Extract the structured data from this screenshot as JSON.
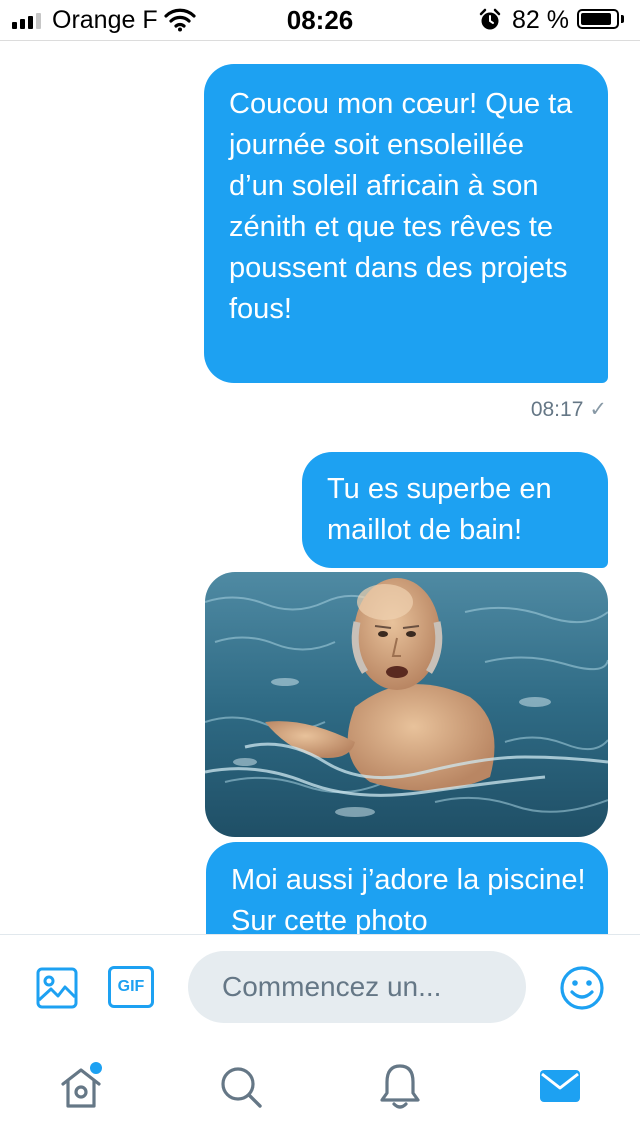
{
  "status_bar": {
    "carrier": "Orange F",
    "time": "08:26",
    "battery_percent": "82 %",
    "signal_bars_active": 3,
    "signal_bars_total": 4,
    "battery_level": 0.82
  },
  "messages": [
    {
      "type": "text",
      "text": "Coucou mon cœur! Que ta journée soit ensoleillée d’un soleil africain à son zénith et que tes rêves te poussent dans des projets fous!",
      "timestamp": "08:17"
    },
    {
      "type": "text",
      "text": "Tu es superbe en maillot de bain!"
    },
    {
      "type": "image",
      "icon": "photo-swimmer"
    },
    {
      "type": "text",
      "text": "Moi aussi j’adore la piscine! Sur cette photo"
    }
  ],
  "composer": {
    "placeholder": "Commencez un...",
    "media_icon": "image-icon",
    "gif_label": "GIF",
    "emoji_icon": "emoji-icon"
  },
  "tab_bar": {
    "items": [
      {
        "name": "home",
        "icon": "home-icon",
        "has_notification_dot": true
      },
      {
        "name": "search",
        "icon": "search-icon"
      },
      {
        "name": "notifications",
        "icon": "bell-icon"
      },
      {
        "name": "messages",
        "icon": "mail-icon",
        "active": true
      }
    ]
  },
  "colors": {
    "accent": "#1da1f2",
    "muted": "#657786",
    "input_bg": "#e6ecf0"
  }
}
